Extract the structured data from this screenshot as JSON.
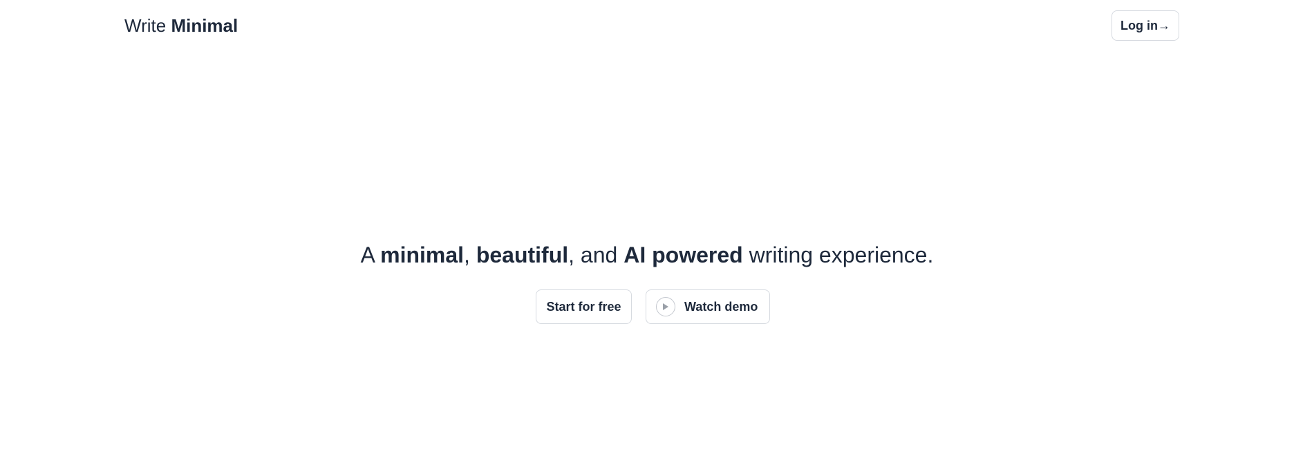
{
  "header": {
    "brand_prefix": "Write",
    "brand_name": "Minimal",
    "login_label": "Log in→"
  },
  "hero": {
    "parts": {
      "p1": "A ",
      "p2": "minimal",
      "p3": ", ",
      "p4": "beautiful",
      "p5": ", and ",
      "p6": "AI powered",
      "p7": " writing experience."
    }
  },
  "cta": {
    "start_label": "Start for free",
    "demo_label": "Watch demo",
    "demo_icon": "play-icon"
  },
  "colors": {
    "text": "#1e293b",
    "border": "#d6dae0",
    "background": "#ffffff",
    "icon": "#9aa0a8"
  }
}
